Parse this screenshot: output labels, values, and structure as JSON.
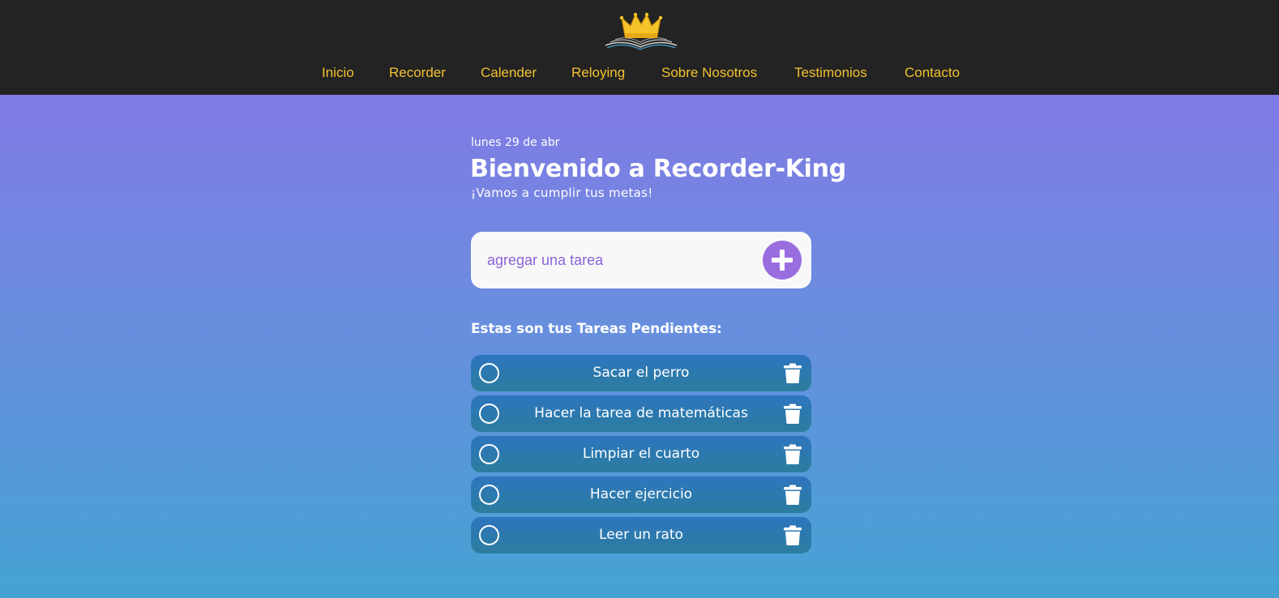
{
  "app": {
    "logo_icon": "crown-book-logo-icon",
    "colors": {
      "topbar": "#232323",
      "nav_link": "#f3c22d",
      "gradient_top": "#8a72e6",
      "gradient_bottom": "#45a3d4",
      "task_bg": "#2d75bf",
      "accent": "#9a6ddf"
    }
  },
  "nav": {
    "items": [
      {
        "label": "Inicio"
      },
      {
        "label": "Recorder"
      },
      {
        "label": "Calender"
      },
      {
        "label": "Reloying"
      },
      {
        "label": "Sobre Nosotros"
      },
      {
        "label": "Testimonios"
      },
      {
        "label": "Contacto"
      }
    ]
  },
  "header": {
    "date": "lunes 29 de abr",
    "title": "Bienvenido a Recorder-King",
    "subtitle": "¡Vamos a cumplir tus metas!"
  },
  "add_task": {
    "value": "",
    "placeholder": "agregar una tarea",
    "button_icon": "plus-icon"
  },
  "tasks": {
    "heading": "Estas son tus Tareas Pendientes:",
    "check_icon": "circle-icon",
    "delete_icon": "trash-icon",
    "items": [
      {
        "text": "Sacar el perro",
        "done": false
      },
      {
        "text": "Hacer la tarea de matemáticas",
        "done": false
      },
      {
        "text": "Limpiar el cuarto",
        "done": false
      },
      {
        "text": "Hacer ejercicio",
        "done": false
      },
      {
        "text": "Leer un rato",
        "done": false
      }
    ]
  }
}
